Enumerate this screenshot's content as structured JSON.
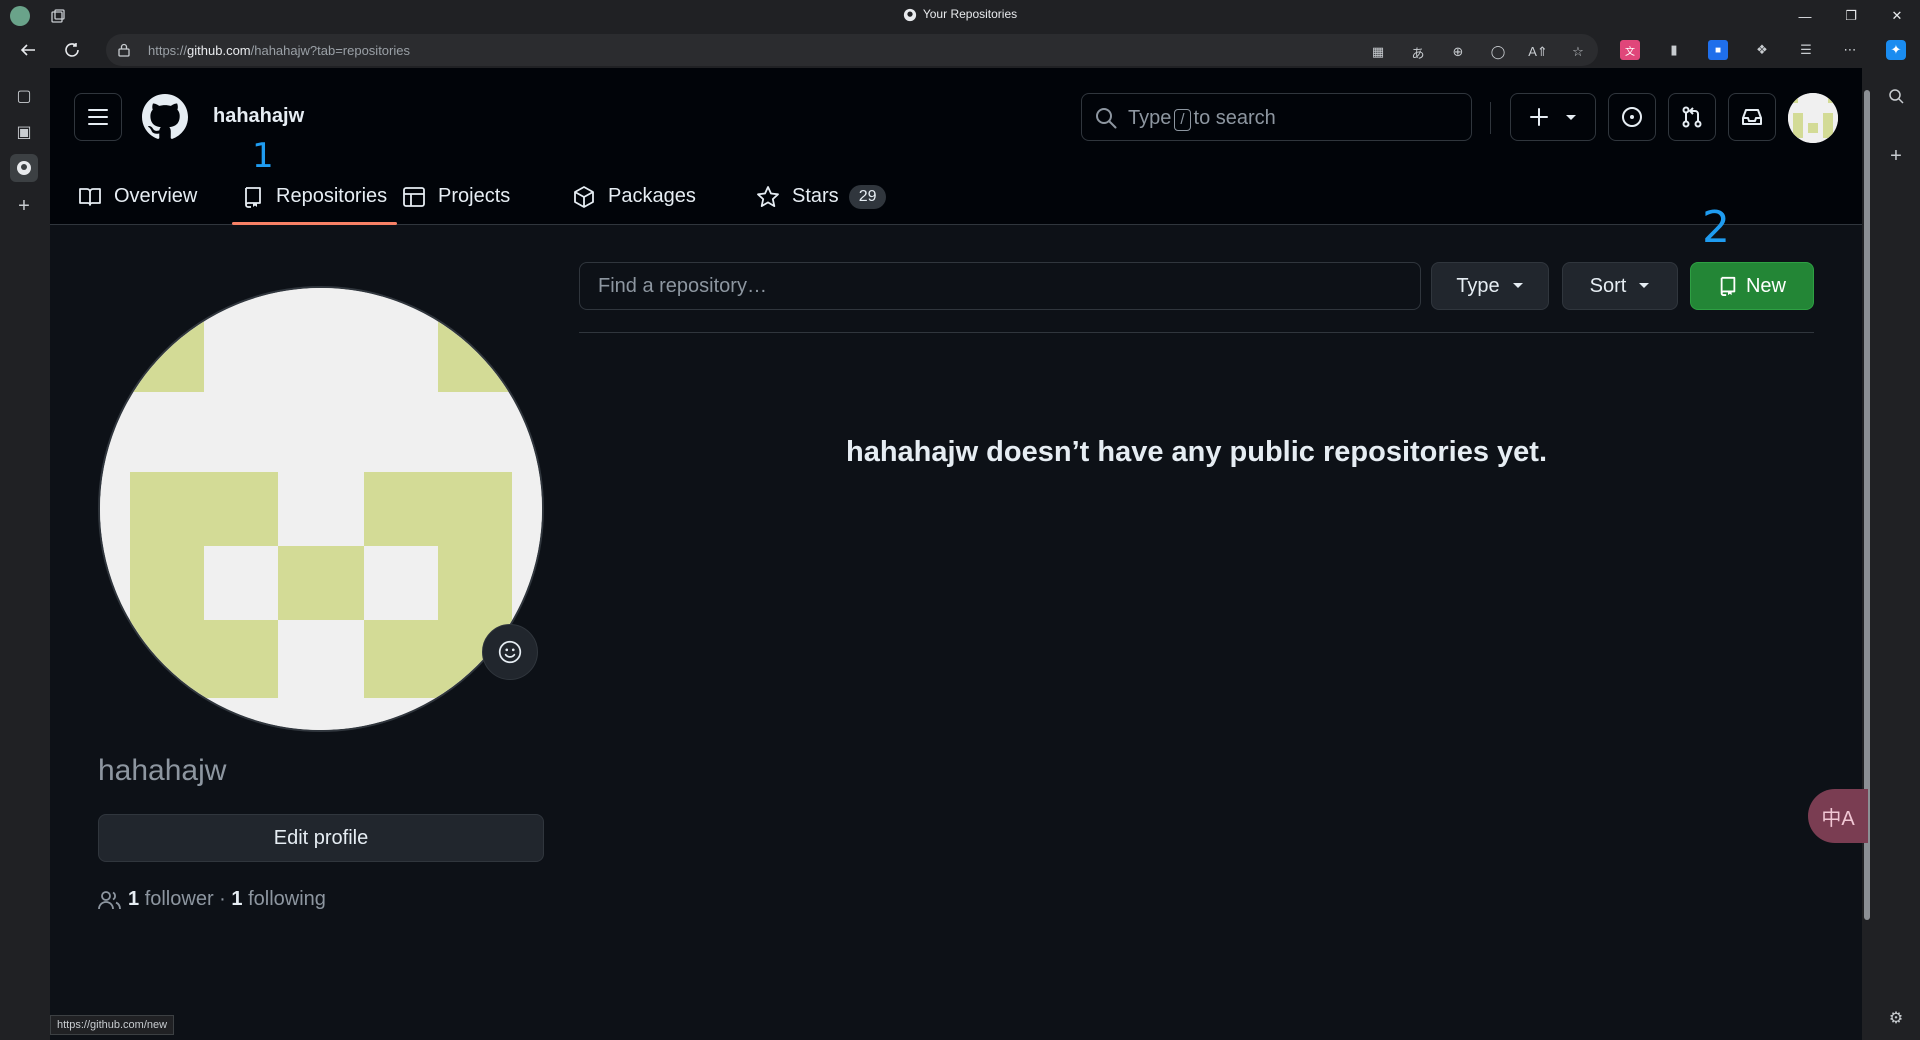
{
  "browser": {
    "window_title": "Your Repositories",
    "url_prefix": "https://",
    "url_host": "github.com",
    "url_path": "/hahahajw?tab=repositories",
    "status_url": "https://github.com/new"
  },
  "header": {
    "username": "hahahajw",
    "search_prefix": "Type",
    "search_key": "/",
    "search_suffix": "to search"
  },
  "tabs": [
    {
      "label": "Overview",
      "icon": "book-icon"
    },
    {
      "label": "Repositories",
      "icon": "repo-icon",
      "active": true
    },
    {
      "label": "Projects",
      "icon": "table-icon"
    },
    {
      "label": "Packages",
      "icon": "package-icon"
    },
    {
      "label": "Stars",
      "icon": "star-icon",
      "count": "29"
    }
  ],
  "annotations": {
    "one": "1",
    "two": "2"
  },
  "profile": {
    "name": "hahahajw",
    "edit_label": "Edit profile",
    "followers_count": "1",
    "followers_label": "follower",
    "separator": "·",
    "following_count": "1",
    "following_label": "following"
  },
  "repos": {
    "search_placeholder": "Find a repository…",
    "type_label": "Type",
    "sort_label": "Sort",
    "new_label": "New",
    "empty_message": "hahahajw doesn’t have any public repositories yet."
  },
  "translate_glyph": "中A",
  "colors": {
    "page_bg": "#0d1117",
    "header_bg": "#010409",
    "accent_green": "#238636",
    "tab_underline": "#f78166",
    "annotation_blue": "#1f9cf0",
    "identicon": "#d3db96"
  }
}
